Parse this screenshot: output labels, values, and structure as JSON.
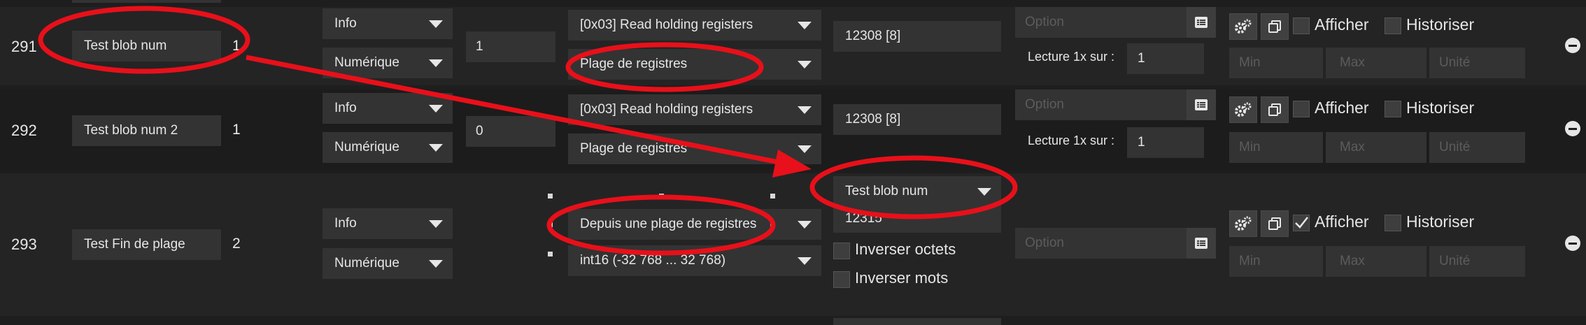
{
  "top_stub": {
    "id_value": ""
  },
  "rows": [
    {
      "id": "291",
      "name": "Test blob num",
      "count": "1",
      "type_select": "Info",
      "subtype_select": "Numérique",
      "offset_value": "1",
      "function_select": "[0x03] Read holding registers",
      "mode_select": "Plage de registres",
      "address_value": "12308 [8]",
      "option_placeholder": "Option",
      "lecture_label": "Lecture 1x sur :",
      "lecture_value": "1",
      "afficher_label": "Afficher",
      "historiser_label": "Historiser",
      "afficher_checked": false,
      "historiser_checked": false,
      "min_placeholder": "Min",
      "max_placeholder": "Max",
      "unite_placeholder": "Unité"
    },
    {
      "id": "292",
      "name": "Test blob num 2",
      "count": "1",
      "type_select": "Info",
      "subtype_select": "Numérique",
      "offset_value": "0",
      "function_select": "[0x03] Read holding registers",
      "mode_select": "Plage de registres",
      "address_value": "12308 [8]",
      "option_placeholder": "Option",
      "lecture_label": "Lecture 1x sur :",
      "lecture_value": "1",
      "afficher_label": "Afficher",
      "historiser_label": "Historiser",
      "afficher_checked": false,
      "historiser_checked": false,
      "min_placeholder": "Min",
      "max_placeholder": "Max",
      "unite_placeholder": "Unité"
    },
    {
      "id": "293",
      "name": "Test Fin de plage",
      "count": "2",
      "type_select": "Info",
      "subtype_select": "Numérique",
      "mode_select": "Depuis une plage de registres",
      "format_select": "int16 (-32 768 ... 32 768)",
      "source_select": "Test blob num",
      "address_value": "12315",
      "inverser_octets_label": "Inverser octets",
      "inverser_mots_label": "Inverser mots",
      "option_placeholder": "Option",
      "afficher_label": "Afficher",
      "historiser_label": "Historiser",
      "afficher_checked": true,
      "historiser_checked": false,
      "min_placeholder": "Min",
      "max_placeholder": "Max",
      "unite_placeholder": "Unité"
    }
  ],
  "icons": {
    "config": "gears-icon",
    "copy": "copy-icon",
    "option": "list-icon",
    "remove": "minus-circle-icon"
  },
  "annotation_color": "#e8101a"
}
